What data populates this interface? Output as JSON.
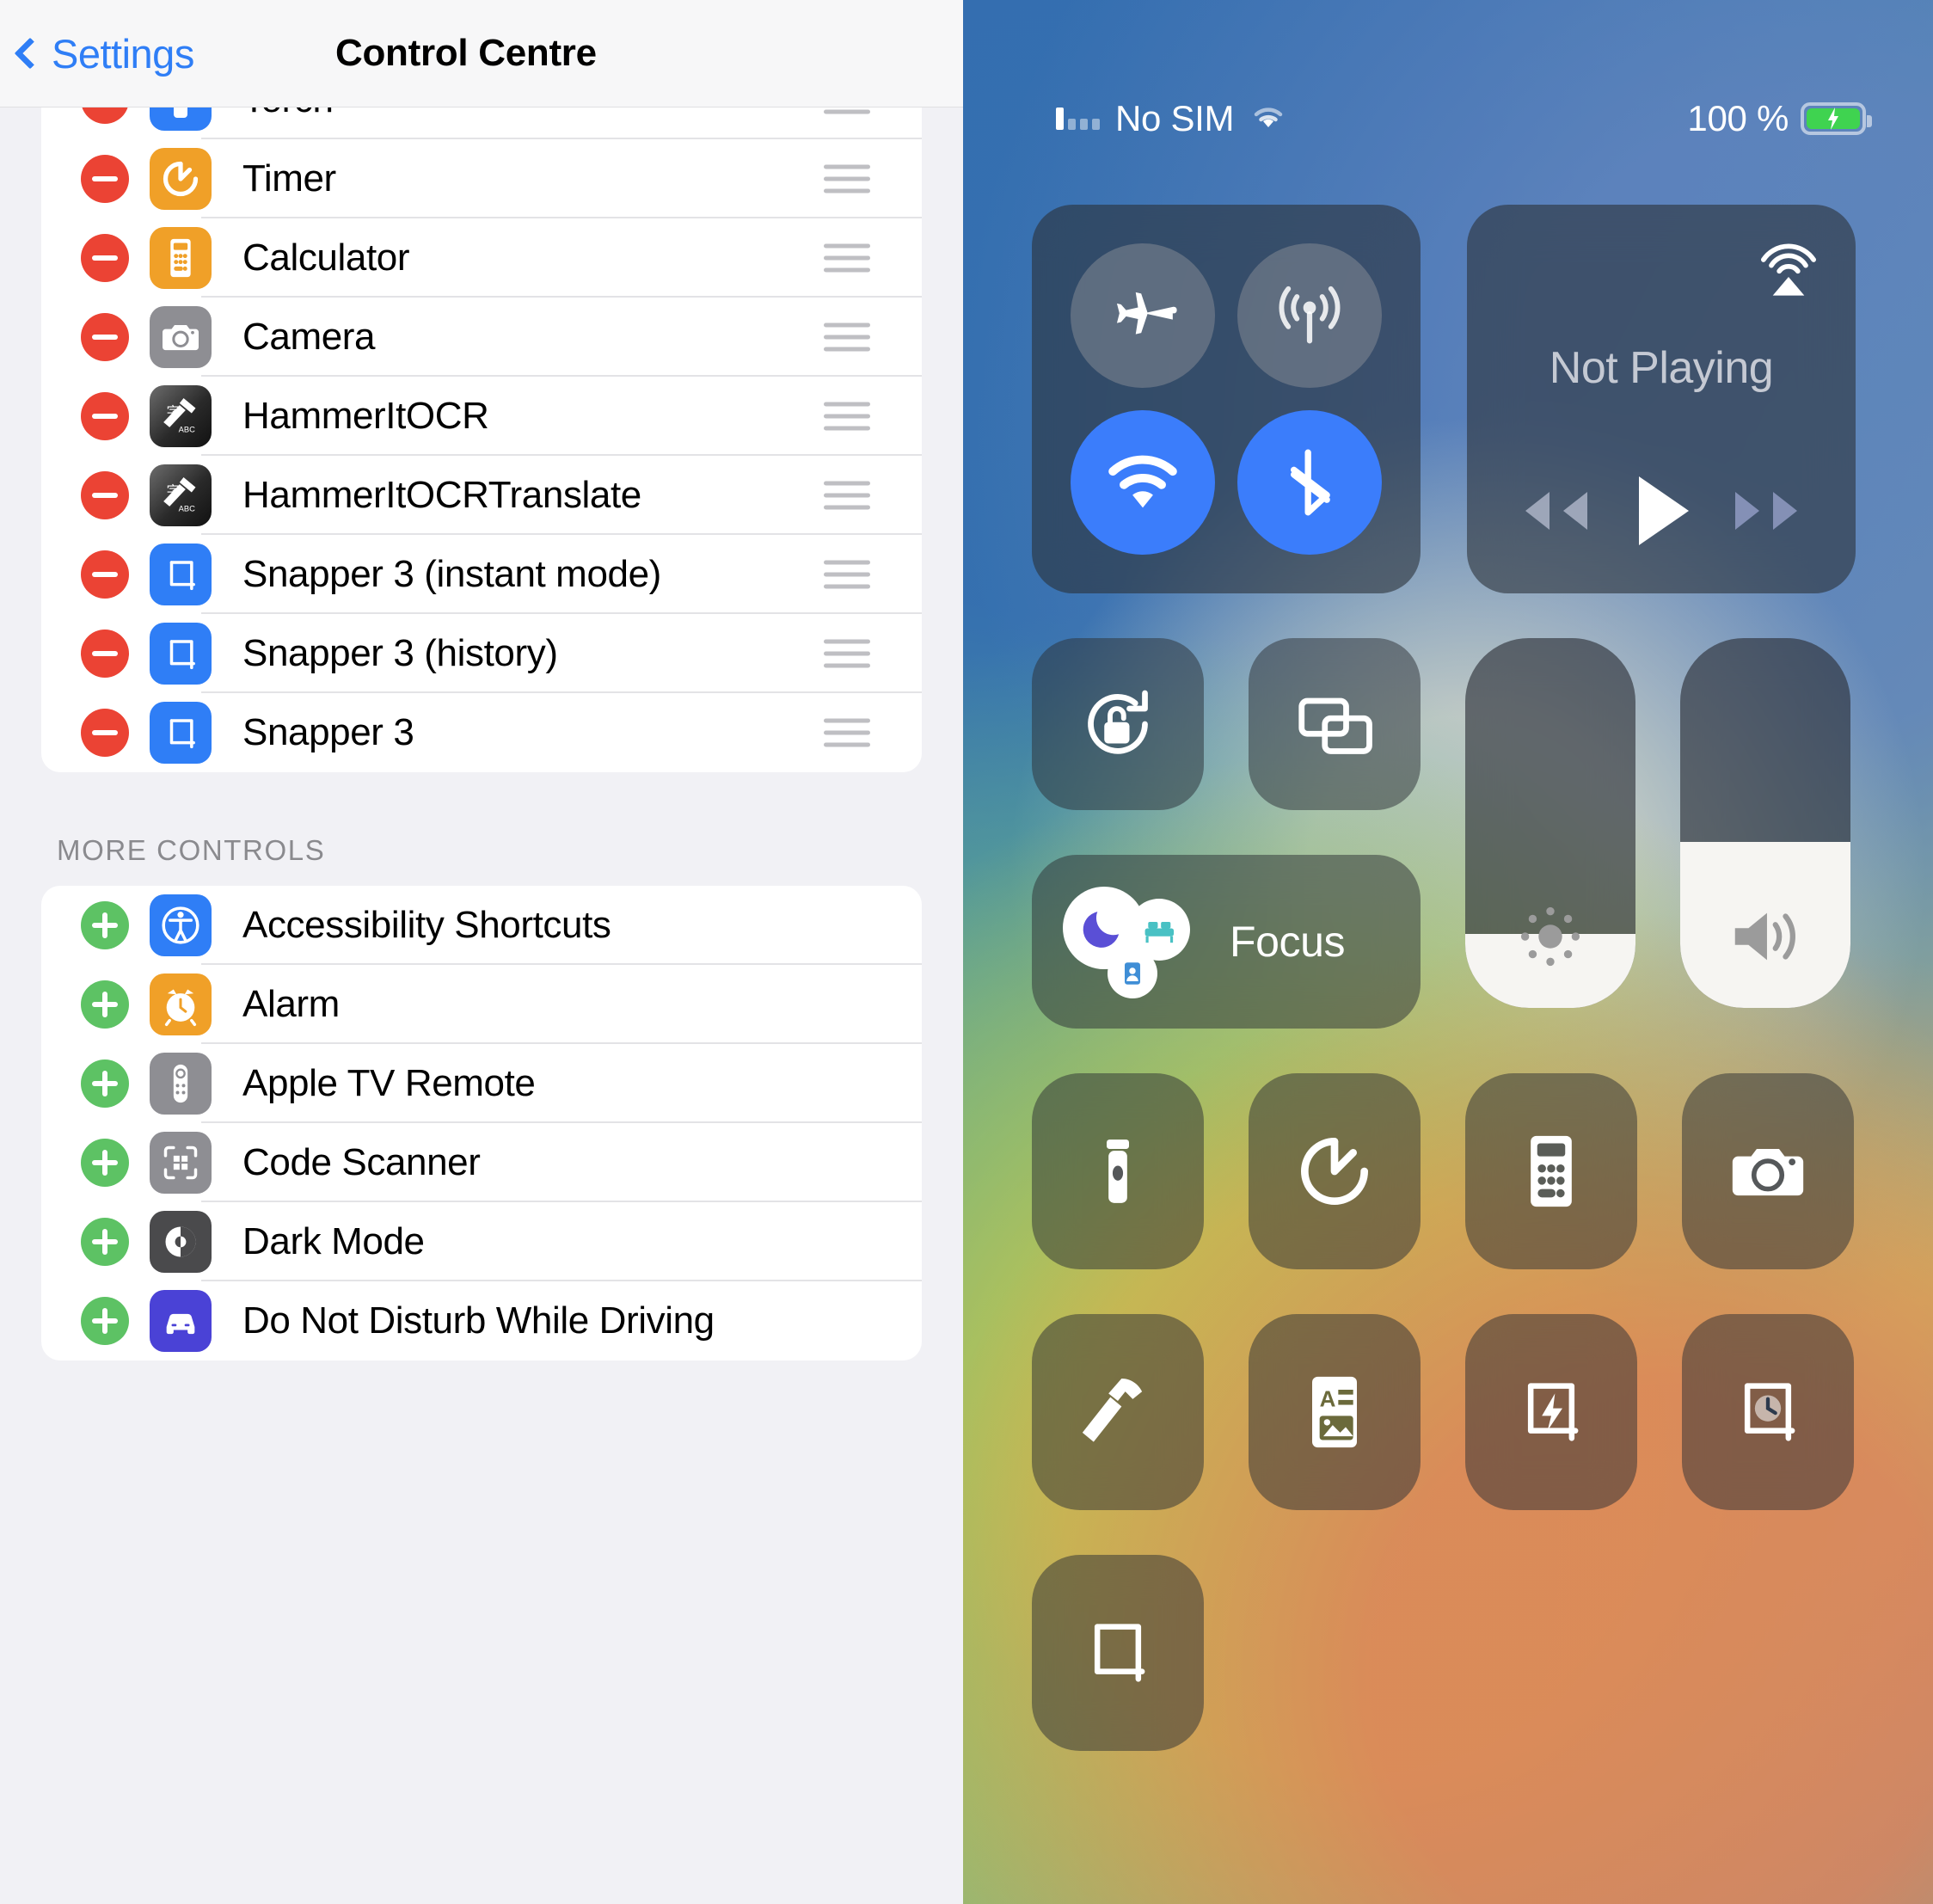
{
  "settings": {
    "nav": {
      "back_label": "Settings",
      "title": "Control Centre"
    },
    "included_controls": [
      {
        "label": "Torch",
        "icon": "torch-icon",
        "action": "remove"
      },
      {
        "label": "Timer",
        "icon": "timer-icon",
        "action": "remove"
      },
      {
        "label": "Calculator",
        "icon": "calculator-icon",
        "action": "remove"
      },
      {
        "label": "Camera",
        "icon": "camera-icon",
        "action": "remove"
      },
      {
        "label": "HammerItOCR",
        "icon": "hammer-ocr-icon",
        "action": "remove"
      },
      {
        "label": "HammerItOCRTranslate",
        "icon": "hammer-ocr-icon",
        "action": "remove"
      },
      {
        "label": "Snapper 3 (instant mode)",
        "icon": "snapper-icon",
        "action": "remove"
      },
      {
        "label": "Snapper 3 (history)",
        "icon": "snapper-icon",
        "action": "remove"
      },
      {
        "label": "Snapper 3",
        "icon": "snapper-icon",
        "action": "remove"
      }
    ],
    "more_controls_header": "MORE CONTROLS",
    "more_controls": [
      {
        "label": "Accessibility Shortcuts",
        "icon": "accessibility-icon",
        "action": "add"
      },
      {
        "label": "Alarm",
        "icon": "alarm-icon",
        "action": "add"
      },
      {
        "label": "Apple TV Remote",
        "icon": "apple-tv-remote-icon",
        "action": "add"
      },
      {
        "label": "Code Scanner",
        "icon": "code-scanner-icon",
        "action": "add"
      },
      {
        "label": "Dark Mode",
        "icon": "dark-mode-icon",
        "action": "add"
      },
      {
        "label": "Do Not Disturb While Driving",
        "icon": "car-icon",
        "action": "add"
      }
    ],
    "colors": {
      "remove": "#eb4334",
      "add": "#5dc264",
      "accent": "#2f7ef6"
    }
  },
  "control_centre": {
    "status_bar": {
      "carrier": "No SIM",
      "battery_percent": "100 %",
      "signal_icon": "signal-bars-icon",
      "wifi_icon": "wifi-icon",
      "battery_icon": "battery-charging-icon"
    },
    "connectivity": {
      "airplane": {
        "name": "airplane-mode-toggle",
        "state": "off"
      },
      "cellular": {
        "name": "cellular-data-toggle",
        "state": "off"
      },
      "wifi": {
        "name": "wifi-toggle",
        "state": "on"
      },
      "bluetooth": {
        "name": "bluetooth-toggle",
        "state": "on"
      }
    },
    "media": {
      "title": "Not Playing",
      "airplay_icon": "airplay-icon",
      "rewind_icon": "rewind-icon",
      "play_icon": "play-icon",
      "forward_icon": "fast-forward-icon"
    },
    "rotation_lock": {
      "label": "rotation-lock-toggle",
      "state": "unlocked"
    },
    "screen_mirroring": {
      "label": "screen-mirroring-toggle"
    },
    "brightness": {
      "label": "brightness-slider",
      "value": 20
    },
    "volume": {
      "label": "volume-slider",
      "value": 45
    },
    "focus": {
      "label": "Focus",
      "modes": [
        "do-not-disturb",
        "sleep",
        "personal"
      ]
    },
    "tiles": [
      {
        "name": "torch-tile",
        "icon": "torch-icon"
      },
      {
        "name": "timer-tile",
        "icon": "timer-icon"
      },
      {
        "name": "calculator-tile",
        "icon": "calculator-icon"
      },
      {
        "name": "camera-tile",
        "icon": "camera-icon"
      },
      {
        "name": "hammer-ocr-tile",
        "icon": "hammer-icon"
      },
      {
        "name": "hammer-ocr-translate-tile",
        "icon": "ocr-translate-icon"
      },
      {
        "name": "snapper-instant-tile",
        "icon": "snapper-instant-icon"
      },
      {
        "name": "snapper-history-tile",
        "icon": "snapper-history-icon"
      },
      {
        "name": "snapper-tile",
        "icon": "snapper-icon"
      }
    ]
  }
}
